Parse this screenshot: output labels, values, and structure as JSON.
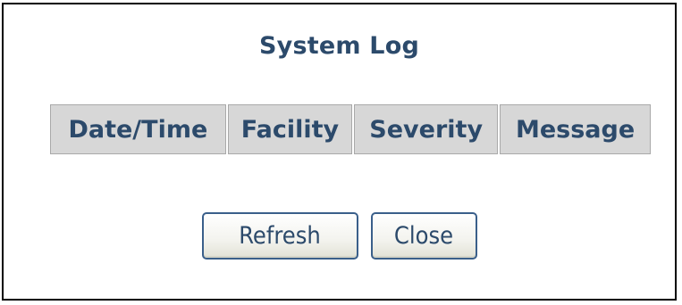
{
  "window": {
    "title": "System Log"
  },
  "log_table": {
    "columns": [
      "Date/Time",
      "Facility",
      "Severity",
      "Message"
    ],
    "rows": []
  },
  "buttons": {
    "refresh_label": "Refresh",
    "close_label": "Close"
  },
  "colors": {
    "text": "#2c4a6b",
    "header_bg": "#d7d7d7",
    "button_border": "#3a5f8a"
  }
}
